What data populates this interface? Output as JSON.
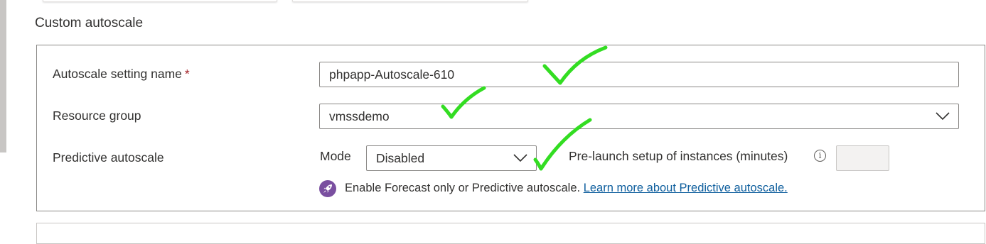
{
  "section": {
    "title": "Custom autoscale"
  },
  "form": {
    "name_label": "Autoscale setting name",
    "required_marker": "*",
    "name_value": "phpapp-Autoscale-610",
    "resource_group_label": "Resource group",
    "resource_group_value": "vmssdemo",
    "predictive_label": "Predictive autoscale",
    "mode_label": "Mode",
    "mode_value": "Disabled",
    "prelaunch_label": "Pre-launch setup of instances (minutes)",
    "prelaunch_value": ""
  },
  "info": {
    "text": "Enable Forecast only or Predictive autoscale.",
    "link": "Learn more about Predictive autoscale."
  },
  "icons": {
    "chevron": "chevron-down-icon",
    "info": "info-icon",
    "rocket": "rocket-icon",
    "annotation": "green-checkmark-annotation"
  },
  "colors": {
    "required": "#a4262c",
    "link": "#0f5f9e",
    "rocket_bg": "#7a4fa0",
    "checkmark": "#33dd22"
  }
}
